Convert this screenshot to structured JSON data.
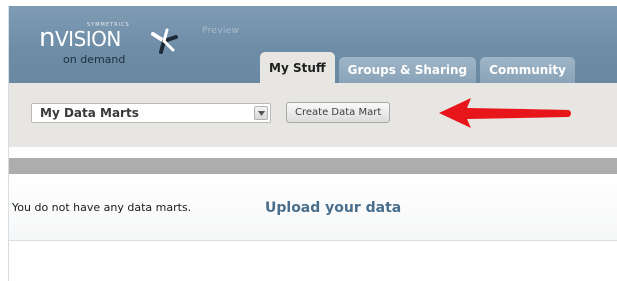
{
  "header": {
    "logo_small_text": "SYMMETRICS",
    "logo_prefix": "n",
    "logo_word": "VISION",
    "logo_sub": "on demand",
    "preview_label": "Preview"
  },
  "tabs": [
    {
      "label": "My Stuff",
      "active": true
    },
    {
      "label": "Groups & Sharing",
      "active": false
    },
    {
      "label": "Community",
      "active": false
    }
  ],
  "toolbar": {
    "select_value": "My Data Marts",
    "create_button_label": "Create Data Mart"
  },
  "content": {
    "empty_message": "You do not have any data marts.",
    "upload_link_label": "Upload your data"
  },
  "colors": {
    "header_bg": "#7592aa",
    "toolbar_bg": "#e7e6e2",
    "link": "#4a6f8d",
    "arrow": "#e8161b"
  }
}
